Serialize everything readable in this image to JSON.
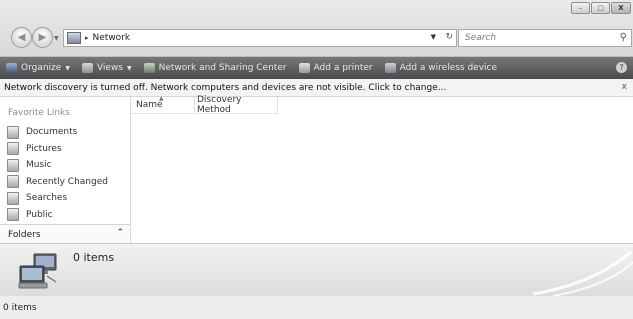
{
  "window": {
    "minimize_glyph": "–",
    "maximize_glyph": "□",
    "close_glyph": "X"
  },
  "navigation": {
    "back_glyph": "◀",
    "forward_glyph": "▶",
    "recent_glyph": "▼",
    "address_path": "Network",
    "address_sep_glyph": "▸",
    "address_drop_glyph": "▼",
    "refresh_glyph": "↻"
  },
  "search": {
    "placeholder": "Search",
    "icon": "search-icon"
  },
  "commands": {
    "organize": "Organize",
    "views": "Views",
    "network_center": "Network and Sharing Center",
    "add_printer": "Add a printer",
    "add_wireless": "Add a wireless device",
    "help_glyph": "?"
  },
  "infobar": {
    "message": "Network discovery is turned off. Network computers and devices are not visible. Click to change...",
    "close_glyph": "x"
  },
  "navpane": {
    "favorites_title": "Favorite Links",
    "favorites": [
      {
        "label": "Documents",
        "icon": "documents-icon"
      },
      {
        "label": "Pictures",
        "icon": "pictures-icon"
      },
      {
        "label": "Music",
        "icon": "music-icon"
      },
      {
        "label": "Recently Changed",
        "icon": "recently-changed-icon"
      },
      {
        "label": "Searches",
        "icon": "searches-icon"
      },
      {
        "label": "Public",
        "icon": "public-icon"
      }
    ],
    "folders_label": "Folders",
    "folders_chevron": "⌃"
  },
  "filelist": {
    "columns": [
      "Name",
      "Discovery Method"
    ],
    "sort_glyph": "▲",
    "items": []
  },
  "details": {
    "count_text": "0 items",
    "icon": "network-computers-icon"
  },
  "status": {
    "text": "0 items"
  }
}
